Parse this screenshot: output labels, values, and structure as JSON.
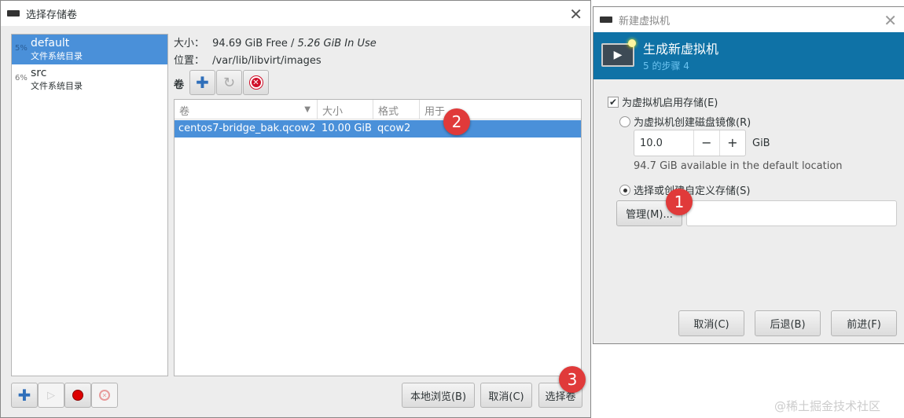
{
  "select_dialog": {
    "title": "选择存储卷",
    "pools": [
      {
        "pct": "5%",
        "name": "default",
        "type": "文件系统目录"
      },
      {
        "pct": "6%",
        "name": "src",
        "type": "文件系统目录"
      }
    ],
    "size_label": "大小：",
    "size_free": "94.69 GiB Free /",
    "size_used": "5.26 GiB In Use",
    "location_label": "位置：",
    "location": "/var/lib/libvirt/images",
    "volumes_label": "卷",
    "columns": [
      "卷",
      "大小",
      "格式",
      "用于"
    ],
    "rows": [
      {
        "name": "centos7-bridge_bak.qcow2",
        "size": "10.00 GiB",
        "format": "qcow2",
        "used_by": ""
      }
    ],
    "browse_local": "本地浏览(B)",
    "cancel": "取消(C)",
    "choose": "选择卷"
  },
  "new_vm": {
    "title": "新建虚拟机",
    "header": "生成新虚拟机",
    "step": "5 的步骤 4",
    "enable_storage": "为虚拟机启用存储(E)",
    "create_disk": "为虚拟机创建磁盘镜像(R)",
    "disk_size": "10.0",
    "unit": "GiB",
    "available": "94.7 GiB available in the default location",
    "custom_storage": "选择或创建自定义存储(S)",
    "manage": "管理(M)...",
    "custom_path": "",
    "cancel": "取消(C)",
    "back": "后退(B)",
    "forward": "前进(F)"
  },
  "badges": [
    "1",
    "2",
    "3"
  ],
  "watermark": "@稀土掘金技术社区"
}
